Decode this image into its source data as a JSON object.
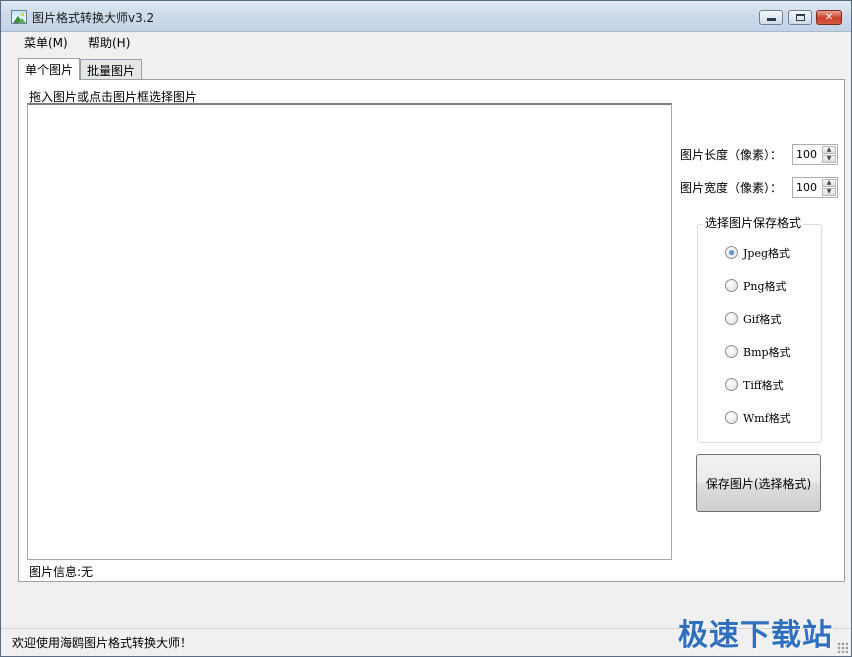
{
  "window": {
    "title": "图片格式转换大师v3.2",
    "controls": {
      "min": "",
      "max": "",
      "close": "✕"
    }
  },
  "menu": {
    "items": [
      {
        "label": "菜单(M)"
      },
      {
        "label": "帮助(H)"
      }
    ]
  },
  "tabs": [
    {
      "label": "单个图片",
      "active": true
    },
    {
      "label": "批量图片",
      "active": false
    }
  ],
  "single": {
    "drop_label": "拖入图片或点击图片框选择图片",
    "info_label": "图片信息:无",
    "length_label": "图片长度（像素）：",
    "length_value": "100",
    "width_label": "图片宽度（像素）：",
    "width_value": "100",
    "format_group_title": "选择图片保存格式",
    "formats": [
      {
        "label": "Jpeg格式",
        "checked": true
      },
      {
        "label": "Png格式",
        "checked": false
      },
      {
        "label": "Gif格式",
        "checked": false
      },
      {
        "label": "Bmp格式",
        "checked": false
      },
      {
        "label": "Tiff格式",
        "checked": false
      },
      {
        "label": "Wmf格式",
        "checked": false
      }
    ],
    "save_button": "保存图片(选择格式)"
  },
  "status": {
    "text": "欢迎使用海鸥图片格式转换大师！"
  },
  "watermark": "极速下载站"
}
